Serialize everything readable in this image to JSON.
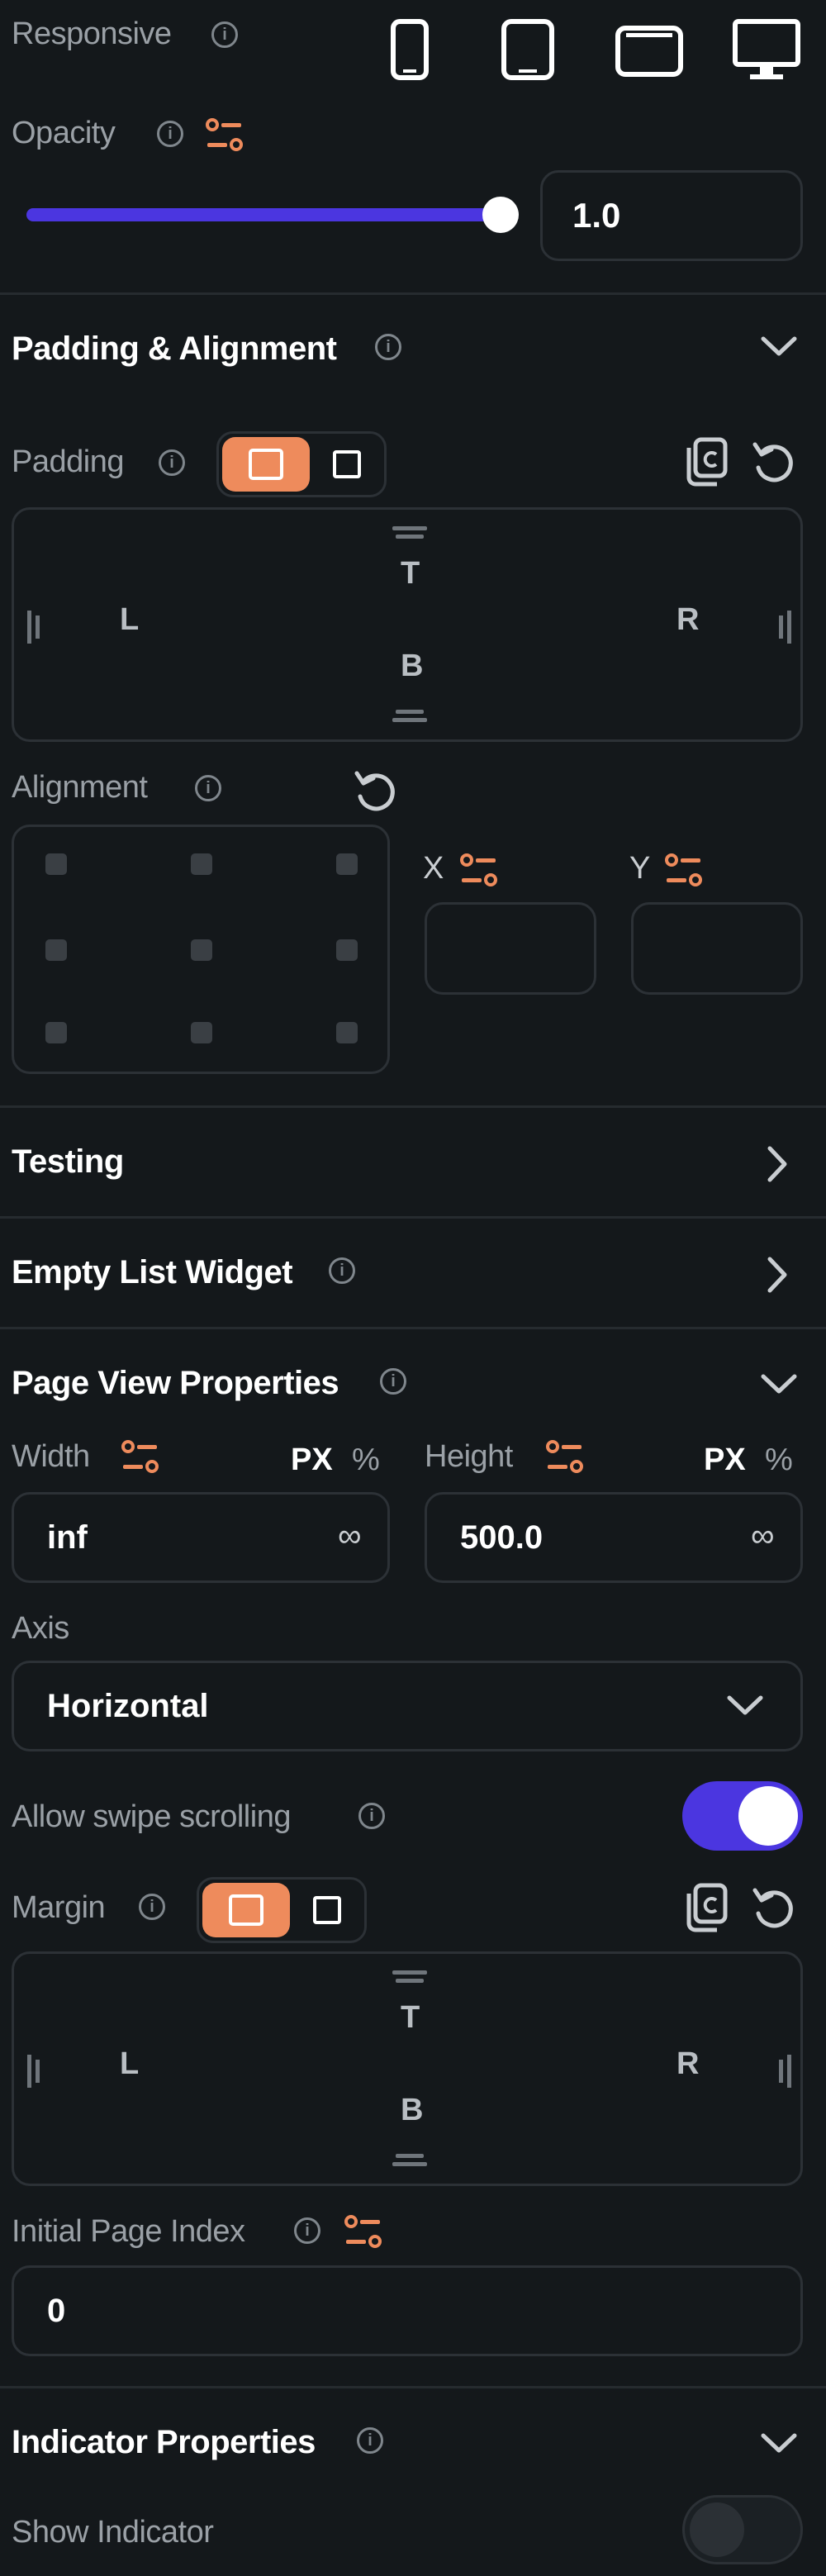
{
  "responsive": {
    "label": "Responsive"
  },
  "opacity": {
    "label": "Opacity",
    "value": "1.0",
    "slider_fraction": 1.0
  },
  "padding_alignment": {
    "title": "Padding & Alignment",
    "padding_label": "Padding",
    "padding_box": {
      "top": "T",
      "bottom": "B",
      "left": "L",
      "right": "R"
    },
    "alignment_label": "Alignment",
    "x_label": "X",
    "y_label": "Y"
  },
  "testing": {
    "title": "Testing"
  },
  "empty_list_widget": {
    "title": "Empty List Widget"
  },
  "page_view_properties": {
    "title": "Page View Properties",
    "width_label": "Width",
    "width_value": "inf",
    "height_label": "Height",
    "height_value": "500.0",
    "unit_px": "PX",
    "unit_pct": "%",
    "infinity": "∞",
    "axis_label": "Axis",
    "axis_value": "Horizontal",
    "swipe_label": "Allow swipe scrolling",
    "swipe_on": true,
    "margin_label": "Margin",
    "margin_box": {
      "top": "T",
      "bottom": "B",
      "left": "L",
      "right": "R"
    },
    "initial_page_label": "Initial Page Index",
    "initial_page_value": "0"
  },
  "indicator_properties": {
    "title": "Indicator Properties",
    "show_indicator_label": "Show Indicator",
    "show_indicator_on": false
  },
  "colors": {
    "accent": "#4b36e0",
    "orange": "#ee8b5c",
    "background": "#14181b"
  }
}
